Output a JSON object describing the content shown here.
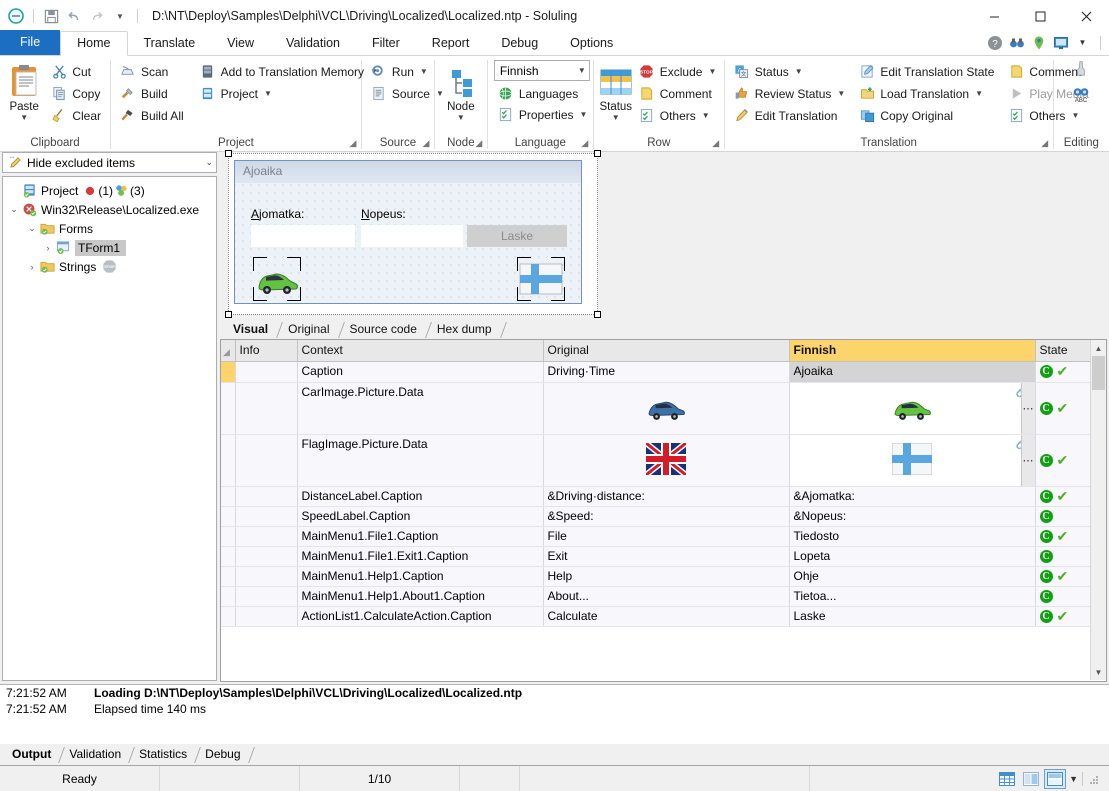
{
  "window": {
    "title": "D:\\NT\\Deploy\\Samples\\Delphi\\VCL\\Driving\\Localized\\Localized.ntp  -  Soluling",
    "minimize": "—",
    "maximize": "☐",
    "close": "✕"
  },
  "quick_access": {
    "app_icon": "soluling-icon",
    "save": "save-icon",
    "undo": "undo-icon",
    "redo": "redo-icon",
    "more": "chevron-down-icon"
  },
  "help_icons": [
    {
      "name": "help-icon",
      "glyph": "?"
    },
    {
      "name": "binoculars-icon",
      "glyph": "●●"
    },
    {
      "name": "location-pin-icon",
      "glyph": "●"
    },
    {
      "name": "monitor-icon",
      "glyph": "■"
    },
    {
      "name": "chevron-down-icon",
      "glyph": "▾"
    }
  ],
  "ribbon_tabs": [
    {
      "label": "File",
      "active": false,
      "style": "file"
    },
    {
      "label": "Home",
      "active": true,
      "style": "normal"
    },
    {
      "label": "Translate",
      "active": false,
      "style": "normal"
    },
    {
      "label": "View",
      "active": false,
      "style": "normal"
    },
    {
      "label": "Validation",
      "active": false,
      "style": "normal"
    },
    {
      "label": "Filter",
      "active": false,
      "style": "normal"
    },
    {
      "label": "Report",
      "active": false,
      "style": "normal"
    },
    {
      "label": "Debug",
      "active": false,
      "style": "normal"
    },
    {
      "label": "Options",
      "active": false,
      "style": "normal"
    }
  ],
  "ribbon": {
    "clipboard": {
      "group_label": "Clipboard",
      "paste": "Paste",
      "cut": "Cut",
      "copy": "Copy",
      "clear": "Clear"
    },
    "project": {
      "group_label": "Project",
      "scan": "Scan",
      "build": "Build",
      "build_all": "Build All",
      "add_to_tm": "Add to Translation Memory",
      "project": "Project"
    },
    "source": {
      "group_label": "Source",
      "run": "Run",
      "source": "Source"
    },
    "node": {
      "group_label": "Node",
      "node": "Node"
    },
    "language": {
      "group_label": "Language",
      "selected_language": "Finnish",
      "languages": "Languages",
      "properties": "Properties"
    },
    "row": {
      "group_label": "Row",
      "status": "Status",
      "exclude": "Exclude",
      "comment": "Comment",
      "others": "Others"
    },
    "translation": {
      "group_label": "Translation",
      "status": "Status",
      "review_status": "Review Status",
      "edit_translation": "Edit Translation",
      "edit_translation_state": "Edit Translation State",
      "load_translation": "Load Translation",
      "copy_original": "Copy Original",
      "comment": "Comment",
      "play_media": "Play Media",
      "others": "Others"
    },
    "editing": {
      "group_label": "Editing",
      "find": "find-icon",
      "spelling": "spelling-icon"
    }
  },
  "sidebar": {
    "filter_label": "Hide excluded items",
    "tree": [
      {
        "label": "Project",
        "icon": "project-icon",
        "indent": 0,
        "expander": "",
        "selected": false,
        "badges": [
          {
            "icon": "error-icon",
            "text": "(1)"
          },
          {
            "icon": "warning-icon",
            "text": "(3)"
          }
        ]
      },
      {
        "label": "Win32\\Release\\Localized.exe",
        "icon": "exe-icon",
        "indent": 1,
        "expander": "⌄",
        "selected": false,
        "badges": []
      },
      {
        "label": "Forms",
        "icon": "folder-icon",
        "indent": 2,
        "expander": "⌄",
        "selected": false,
        "badges": []
      },
      {
        "label": "TForm1",
        "icon": "form-icon",
        "indent": 3,
        "expander": "›",
        "selected": true,
        "badges": []
      },
      {
        "label": "Strings",
        "icon": "folder-icon",
        "indent": 2,
        "expander": "›",
        "selected": false,
        "badges": [
          {
            "icon": "stop-icon",
            "text": ""
          }
        ]
      }
    ]
  },
  "preview": {
    "form_caption": "Ajoaika",
    "distance_label": "Ajomatka:",
    "distance_accel": "A",
    "speed_label": "Nopeus:",
    "speed_accel": "N",
    "calculate_button": "Laske",
    "car_image": "green-car-image",
    "flag_image": "finland-flag-image"
  },
  "view_tabs": [
    {
      "label": "Visual",
      "active": true
    },
    {
      "label": "Original",
      "active": false
    },
    {
      "label": "Source code",
      "active": false
    },
    {
      "label": "Hex dump",
      "active": false
    }
  ],
  "grid": {
    "columns": [
      {
        "key": "mark",
        "label": "",
        "lang": false
      },
      {
        "key": "info",
        "label": "Info",
        "lang": false
      },
      {
        "key": "context",
        "label": "Context",
        "lang": false
      },
      {
        "key": "original",
        "label": "Original",
        "lang": false
      },
      {
        "key": "finnish",
        "label": "Finnish",
        "lang": true
      },
      {
        "key": "state",
        "label": "State",
        "lang": false
      }
    ],
    "rows": [
      {
        "context": "Caption",
        "original": "Driving·Time",
        "original_type": "text",
        "finnish": "Ajoaika",
        "finnish_type": "text",
        "selected": true,
        "first": true,
        "state": {
          "c": "C",
          "tick": true
        },
        "tall": false
      },
      {
        "context": "CarImage.Picture.Data",
        "original": "blue-car-image",
        "original_type": "image",
        "finnish": "green-car-image",
        "finnish_type": "image",
        "selected": false,
        "first": false,
        "state": {
          "c": "C",
          "tick": true
        },
        "tall": true
      },
      {
        "context": "FlagImage.Picture.Data",
        "original": "uk-flag-image",
        "original_type": "image",
        "finnish": "finland-flag-image",
        "finnish_type": "image",
        "selected": false,
        "first": false,
        "state": {
          "c": "C",
          "tick": true
        },
        "tall": true
      },
      {
        "context": "DistanceLabel.Caption",
        "original": "&Driving·distance:",
        "original_type": "text",
        "finnish": "&Ajomatka:",
        "finnish_type": "text",
        "selected": false,
        "first": false,
        "state": {
          "c": "C",
          "tick": true
        },
        "tall": false
      },
      {
        "context": "SpeedLabel.Caption",
        "original": "&Speed:",
        "original_type": "text",
        "finnish": "&Nopeus:",
        "finnish_type": "text",
        "selected": false,
        "first": false,
        "state": {
          "c": "C",
          "tick": false
        },
        "tall": false
      },
      {
        "context": "MainMenu1.File1.Caption",
        "original": "File",
        "original_type": "text",
        "finnish": "Tiedosto",
        "finnish_type": "text",
        "selected": false,
        "first": false,
        "state": {
          "c": "C",
          "tick": true
        },
        "tall": false
      },
      {
        "context": "MainMenu1.File1.Exit1.Caption",
        "original": "Exit",
        "original_type": "text",
        "finnish": "Lopeta",
        "finnish_type": "text",
        "selected": false,
        "first": false,
        "state": {
          "c": "C",
          "tick": false
        },
        "tall": false
      },
      {
        "context": "MainMenu1.Help1.Caption",
        "original": "Help",
        "original_type": "text",
        "finnish": "Ohje",
        "finnish_type": "text",
        "selected": false,
        "first": false,
        "state": {
          "c": "C",
          "tick": true
        },
        "tall": false
      },
      {
        "context": "MainMenu1.Help1.About1.Caption",
        "original": "About...",
        "original_type": "text",
        "finnish": "Tietoa...",
        "finnish_type": "text",
        "selected": false,
        "first": false,
        "state": {
          "c": "C",
          "tick": false
        },
        "tall": false
      },
      {
        "context": "ActionList1.CalculateAction.Caption",
        "original": "Calculate",
        "original_type": "text",
        "finnish": "Laske",
        "finnish_type": "text",
        "selected": false,
        "first": false,
        "state": {
          "c": "C",
          "tick": true
        },
        "tall": false
      }
    ]
  },
  "output": {
    "lines": [
      {
        "time": "7:21:52 AM",
        "message": "Loading D:\\NT\\Deploy\\Samples\\Delphi\\VCL\\Driving\\Localized\\Localized.ntp",
        "bold": true
      },
      {
        "time": "7:21:52 AM",
        "message": "Elapsed time 140 ms",
        "bold": false
      }
    ]
  },
  "bottom_tabs": [
    {
      "label": "Output",
      "active": true
    },
    {
      "label": "Validation",
      "active": false
    },
    {
      "label": "Statistics",
      "active": false
    },
    {
      "label": "Debug",
      "active": false
    }
  ],
  "statusbar": {
    "ready": "Ready",
    "position": "1/10",
    "view_buttons": [
      {
        "name": "grid-view-button",
        "selected": false
      },
      {
        "name": "split-view-button",
        "selected": false
      },
      {
        "name": "stacked-view-button",
        "selected": true
      }
    ],
    "view_dropdown": "▾"
  },
  "colors": {
    "accent": "#1b6ec2",
    "lang_header": "#fbd46c",
    "selection": "#d4d4d4",
    "ok_green": "#10a010"
  }
}
